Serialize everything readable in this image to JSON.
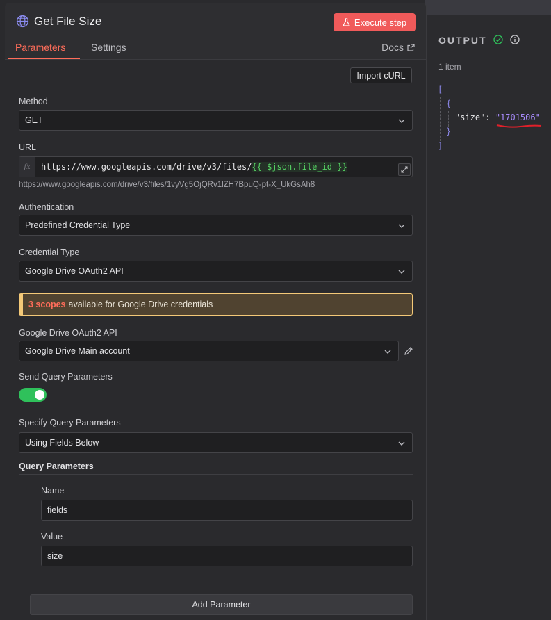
{
  "node": {
    "title": "Get File Size",
    "execute_label": "Execute step",
    "tabs": [
      {
        "label": "Parameters"
      },
      {
        "label": "Settings"
      }
    ],
    "docs_label": "Docs"
  },
  "params": {
    "import_curl_label": "Import cURL",
    "method": {
      "label": "Method",
      "value": "GET"
    },
    "url": {
      "label": "URL",
      "fx": "fx",
      "prefix": "https://www.googleapis.com/drive/v3/files/",
      "expression": "{{ $json.file_id }}",
      "resolved": "https://www.googleapis.com/drive/v3/files/1vyVg5OjQRv1lZH7BpuQ-pt-X_UkGsAh8"
    },
    "authentication": {
      "label": "Authentication",
      "value": "Predefined Credential Type"
    },
    "credential_type": {
      "label": "Credential Type",
      "value": "Google Drive OAuth2 API"
    },
    "notice": {
      "highlight": "3 scopes",
      "text": "available for Google Drive credentials"
    },
    "credential": {
      "label": "Google Drive OAuth2 API",
      "value": "Google Drive Main account"
    },
    "send_query": {
      "label": "Send Query Parameters",
      "enabled": true
    },
    "specify_query": {
      "label": "Specify Query Parameters",
      "value": "Using Fields Below"
    },
    "query_section_title": "Query Parameters",
    "query_param": {
      "name_label": "Name",
      "name_value": "fields",
      "value_label": "Value",
      "value_value": "size"
    },
    "add_parameter_label": "Add Parameter"
  },
  "output": {
    "title": "OUTPUT",
    "count": "1 item",
    "json": {
      "open_array": "[",
      "open_obj": "{",
      "key": "\"size\":",
      "value": "\"1701506\"",
      "close_obj": "}",
      "close_array": "]"
    }
  },
  "colors": {
    "accent": "#ff6d5a",
    "execute": "#f05a5a",
    "toggle_on": "#2fc15b",
    "notice_border": "#f4c978",
    "expression": "#56d364",
    "json_value": "#a78bfa"
  },
  "icons": {
    "title": "globe-icon",
    "execute": "flask-icon",
    "docs": "external-link-icon",
    "select": "chevron-down-icon",
    "expand": "expand-icon",
    "edit": "pencil-icon",
    "status": "check-circle-icon",
    "info": "info-icon"
  }
}
